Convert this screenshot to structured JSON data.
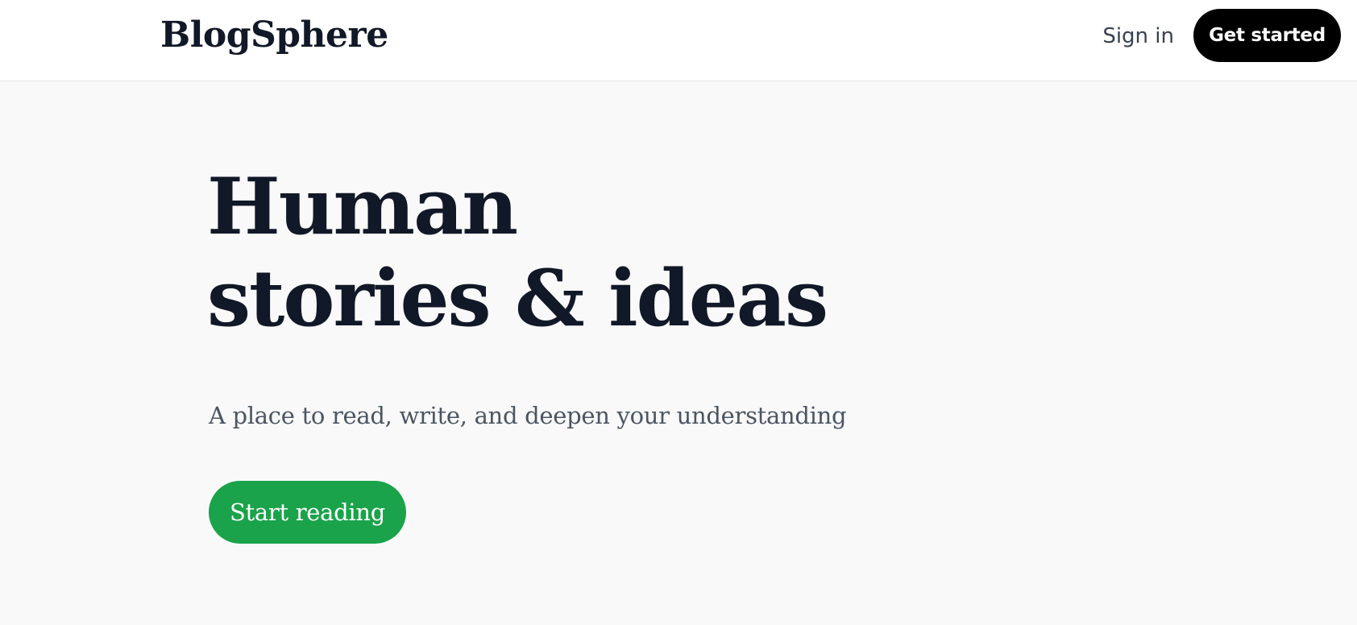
{
  "header": {
    "logo_text": "BlogSphere",
    "signin_label": "Sign in",
    "get_started_label": "Get started"
  },
  "hero": {
    "title_line1": "Human",
    "title_line2": "stories & ideas",
    "tagline": "A place to read, write, and deepen your understanding",
    "cta_label": "Start reading"
  },
  "colors": {
    "page_background": "#f9f9f9",
    "header_background": "#ffffff",
    "primary_text": "#111827",
    "secondary_text": "#4b5563",
    "get_started_background": "#000000",
    "cta_background": "#1aa34a"
  }
}
